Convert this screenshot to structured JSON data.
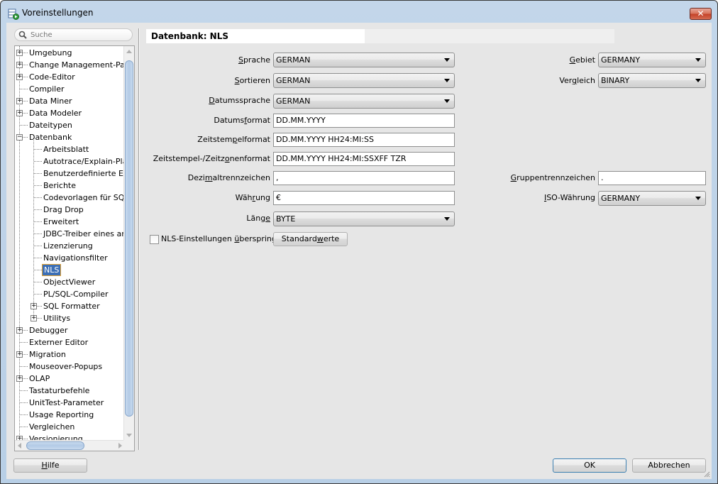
{
  "window": {
    "title": "Voreinstellungen",
    "close_label": "✕"
  },
  "search": {
    "placeholder": "Suche",
    "value": ""
  },
  "tree": {
    "items": [
      {
        "label": "Umgebung",
        "level": 0,
        "expander": "+"
      },
      {
        "label": "Change Management-Parar",
        "level": 0,
        "expander": "+"
      },
      {
        "label": "Code-Editor",
        "level": 0,
        "expander": "+"
      },
      {
        "label": "Compiler",
        "level": 0,
        "expander": ""
      },
      {
        "label": "Data Miner",
        "level": 0,
        "expander": "+"
      },
      {
        "label": "Data Modeler",
        "level": 0,
        "expander": "+"
      },
      {
        "label": "Dateitypen",
        "level": 0,
        "expander": ""
      },
      {
        "label": "Datenbank",
        "level": 0,
        "expander": "−"
      },
      {
        "label": "Arbeitsblatt",
        "level": 1,
        "expander": ""
      },
      {
        "label": "Autotrace/Explain-Plan",
        "level": 1,
        "expander": ""
      },
      {
        "label": "Benutzerdefinierte Erw",
        "level": 1,
        "expander": ""
      },
      {
        "label": "Berichte",
        "level": 1,
        "expander": ""
      },
      {
        "label": "Codevorlagen für SQL-",
        "level": 1,
        "expander": ""
      },
      {
        "label": "Drag  Drop",
        "level": 1,
        "expander": ""
      },
      {
        "label": "Erweitert",
        "level": 1,
        "expander": ""
      },
      {
        "label": "JDBC-Treiber eines and",
        "level": 1,
        "expander": ""
      },
      {
        "label": "Lizenzierung",
        "level": 1,
        "expander": ""
      },
      {
        "label": "Navigationsfilter",
        "level": 1,
        "expander": ""
      },
      {
        "label": "NLS",
        "level": 1,
        "expander": "",
        "selected": true
      },
      {
        "label": "ObjectViewer",
        "level": 1,
        "expander": ""
      },
      {
        "label": "PL/SQL-Compiler",
        "level": 1,
        "expander": ""
      },
      {
        "label": "SQL Formatter",
        "level": 1,
        "expander": "+"
      },
      {
        "label": "Utilitys",
        "level": 1,
        "expander": "+"
      },
      {
        "label": "Debugger",
        "level": 0,
        "expander": "+"
      },
      {
        "label": "Externer Editor",
        "level": 0,
        "expander": ""
      },
      {
        "label": "Migration",
        "level": 0,
        "expander": "+"
      },
      {
        "label": "Mouseover-Popups",
        "level": 0,
        "expander": ""
      },
      {
        "label": "OLAP",
        "level": 0,
        "expander": "+"
      },
      {
        "label": "Tastaturbefehle",
        "level": 0,
        "expander": ""
      },
      {
        "label": "UnitTest-Parameter",
        "level": 0,
        "expander": ""
      },
      {
        "label": "Usage Reporting",
        "level": 0,
        "expander": ""
      },
      {
        "label": "Vergleichen",
        "level": 0,
        "expander": ""
      },
      {
        "label": "Versionierung",
        "level": 0,
        "expander": "+"
      }
    ]
  },
  "panel": {
    "title": "Datenbank: NLS",
    "fields": {
      "sprache": {
        "label_pre": "",
        "label_u": "S",
        "label_post": "prache",
        "value": "GERMAN"
      },
      "sortieren": {
        "label_pre": "",
        "label_u": "S",
        "label_post": "ortieren",
        "value": "GERMAN"
      },
      "datumssprache": {
        "label_pre": "",
        "label_u": "D",
        "label_post": "atumssprache",
        "value": "GERMAN"
      },
      "datumsformat": {
        "label_pre": "Datums",
        "label_u": "f",
        "label_post": "ormat",
        "value": "DD.MM.YYYY"
      },
      "zeitstempelformat": {
        "label_pre": "Zeitstem",
        "label_u": "p",
        "label_post": "elformat",
        "value": "DD.MM.YYYY HH24:MI:SS"
      },
      "zeitzonenformat": {
        "label_pre": "Zeitstempel-/Zeitz",
        "label_u": "o",
        "label_post": "nenformat",
        "value": "DD.MM.YYYY HH24:MI:SSXFF TZR"
      },
      "dezimaltrennzeichen": {
        "label_pre": "Dezi",
        "label_u": "m",
        "label_post": "altrennzeichen",
        "value": ","
      },
      "waehrung": {
        "label_pre": "Wäh",
        "label_u": "r",
        "label_post": "ung",
        "value": "€"
      },
      "laenge": {
        "label_pre": "Läng",
        "label_u": "e",
        "label_post": "",
        "value": "BYTE"
      },
      "gebiet": {
        "label_pre": "",
        "label_u": "G",
        "label_post": "ebiet",
        "value": "GERMANY"
      },
      "vergleich": {
        "label_pre": "Ver",
        "label_u": "g",
        "label_post": "leich",
        "value": "BINARY"
      },
      "gruppentrennzeichen": {
        "label_pre": "",
        "label_u": "G",
        "label_post": "ruppentrennzeichen",
        "value": "."
      },
      "iso_waehrung": {
        "label_pre": "",
        "label_u": "I",
        "label_post": "SO-Währung",
        "value": "GERMANY"
      }
    },
    "skip_nls": {
      "label_pre": "NLS-Einstellungen ",
      "label_u": "ü",
      "label_post": "berspringen",
      "checked": false
    },
    "defaults_button": {
      "label_pre": "Standard",
      "label_u": "w",
      "label_post": "erte"
    }
  },
  "footer": {
    "help": {
      "label_pre": "",
      "label_u": "H",
      "label_post": "ilfe"
    },
    "ok": "OK",
    "cancel": "Abbrechen"
  }
}
